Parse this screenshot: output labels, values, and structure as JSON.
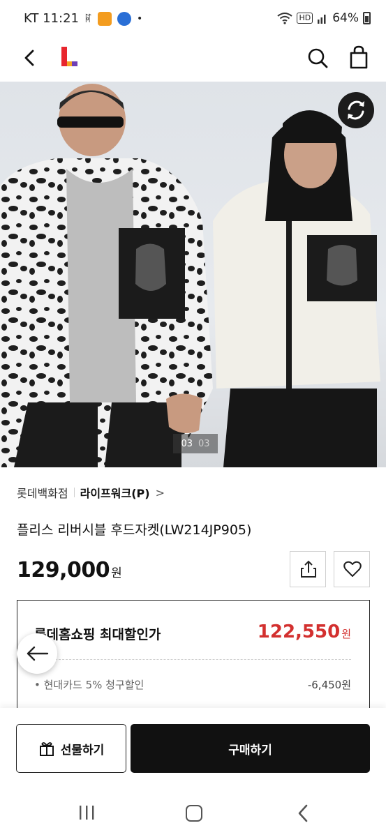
{
  "status_bar": {
    "carrier_time": "KT 11:21",
    "lte_glyph": "ꌸ",
    "dot": "•",
    "hd": "HD",
    "battery": "64%"
  },
  "header": {
    "logo_letter": "L",
    "logo_color": "#e8262e",
    "logo_accent": "#6f3fb5"
  },
  "hero": {
    "image_index": "03",
    "image_total": "03"
  },
  "product": {
    "store": "롯데백화점",
    "brand": "라이프워크(P)",
    "brand_chevron": ">",
    "name": "플리스 리버시블 후드자켓(LW214JP905)",
    "price": "129,000",
    "price_unit": "원"
  },
  "discount": {
    "title": "롯데홈쇼핑 최대할인가",
    "price": "122,550",
    "price_unit": "원",
    "price_color": "#d3302f",
    "coupon_label": "• 현대카드 5% 청구할인",
    "coupon_amount": "-6,450원"
  },
  "actions": {
    "gift_label": "선물하기",
    "buy_label": "구매하기"
  }
}
